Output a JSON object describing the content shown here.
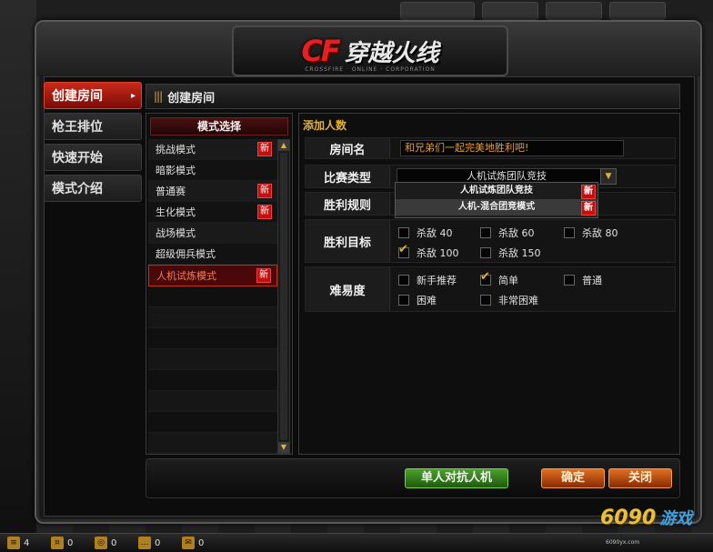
{
  "logo": {
    "cf": "CF",
    "title": "穿越火线",
    "subtitle": "CROSSFIRE · ONLINE · CORPORATION"
  },
  "nav": [
    {
      "label": "创建房间",
      "active": true
    },
    {
      "label": "枪王排位",
      "active": false
    },
    {
      "label": "快速开始",
      "active": false
    },
    {
      "label": "模式介绍",
      "active": false
    }
  ],
  "page_title": "创建房间",
  "mode_select": {
    "header": "模式选择",
    "new_badge": "新",
    "modes": [
      {
        "label": "挑战模式",
        "new": true
      },
      {
        "label": "暗影模式",
        "new": false
      },
      {
        "label": "普通赛",
        "new": true
      },
      {
        "label": "生化模式",
        "new": true
      },
      {
        "label": "战场模式",
        "new": false
      },
      {
        "label": "超级佣兵模式",
        "new": false
      },
      {
        "label": "人机试炼模式",
        "new": true,
        "selected": true
      }
    ]
  },
  "settings": {
    "add_people": "添加人数",
    "room_name_label": "房间名",
    "room_name_value": "和兄弟们一起完美地胜利吧!",
    "match_type_label": "比赛类型",
    "match_type_value": "人机试炼团队竞技",
    "win_rule_label": "胜利规则",
    "dropdown_options": [
      "人机试炼团队竞技",
      "人机-混合团竞模式"
    ],
    "win_target_label": "胜利目标",
    "win_targets": [
      {
        "label": "杀敌 40",
        "checked": false
      },
      {
        "label": "杀敌 60",
        "checked": false
      },
      {
        "label": "杀敌 80",
        "checked": false
      },
      {
        "label": "杀敌 100",
        "checked": true
      },
      {
        "label": "杀敌 150",
        "checked": false
      }
    ],
    "difficulty_label": "难易度",
    "difficulties": [
      {
        "label": "新手推荐",
        "checked": false
      },
      {
        "label": "简单",
        "checked": true
      },
      {
        "label": "普通",
        "checked": false
      },
      {
        "label": "困难",
        "checked": false
      },
      {
        "label": "非常困难",
        "checked": false
      }
    ]
  },
  "buttons": {
    "single": "单人对抗人机",
    "confirm": "确定",
    "close": "关闭"
  },
  "taskbar": [
    {
      "icon": "≡",
      "value": "4"
    },
    {
      "icon": "¤",
      "value": "0"
    },
    {
      "icon": "◎",
      "value": "0"
    },
    {
      "icon": "…",
      "value": "0"
    },
    {
      "icon": "✉",
      "value": "0"
    }
  ],
  "watermark": {
    "num": "6090",
    "cn": "游戏",
    "url": "6090yx.com"
  }
}
